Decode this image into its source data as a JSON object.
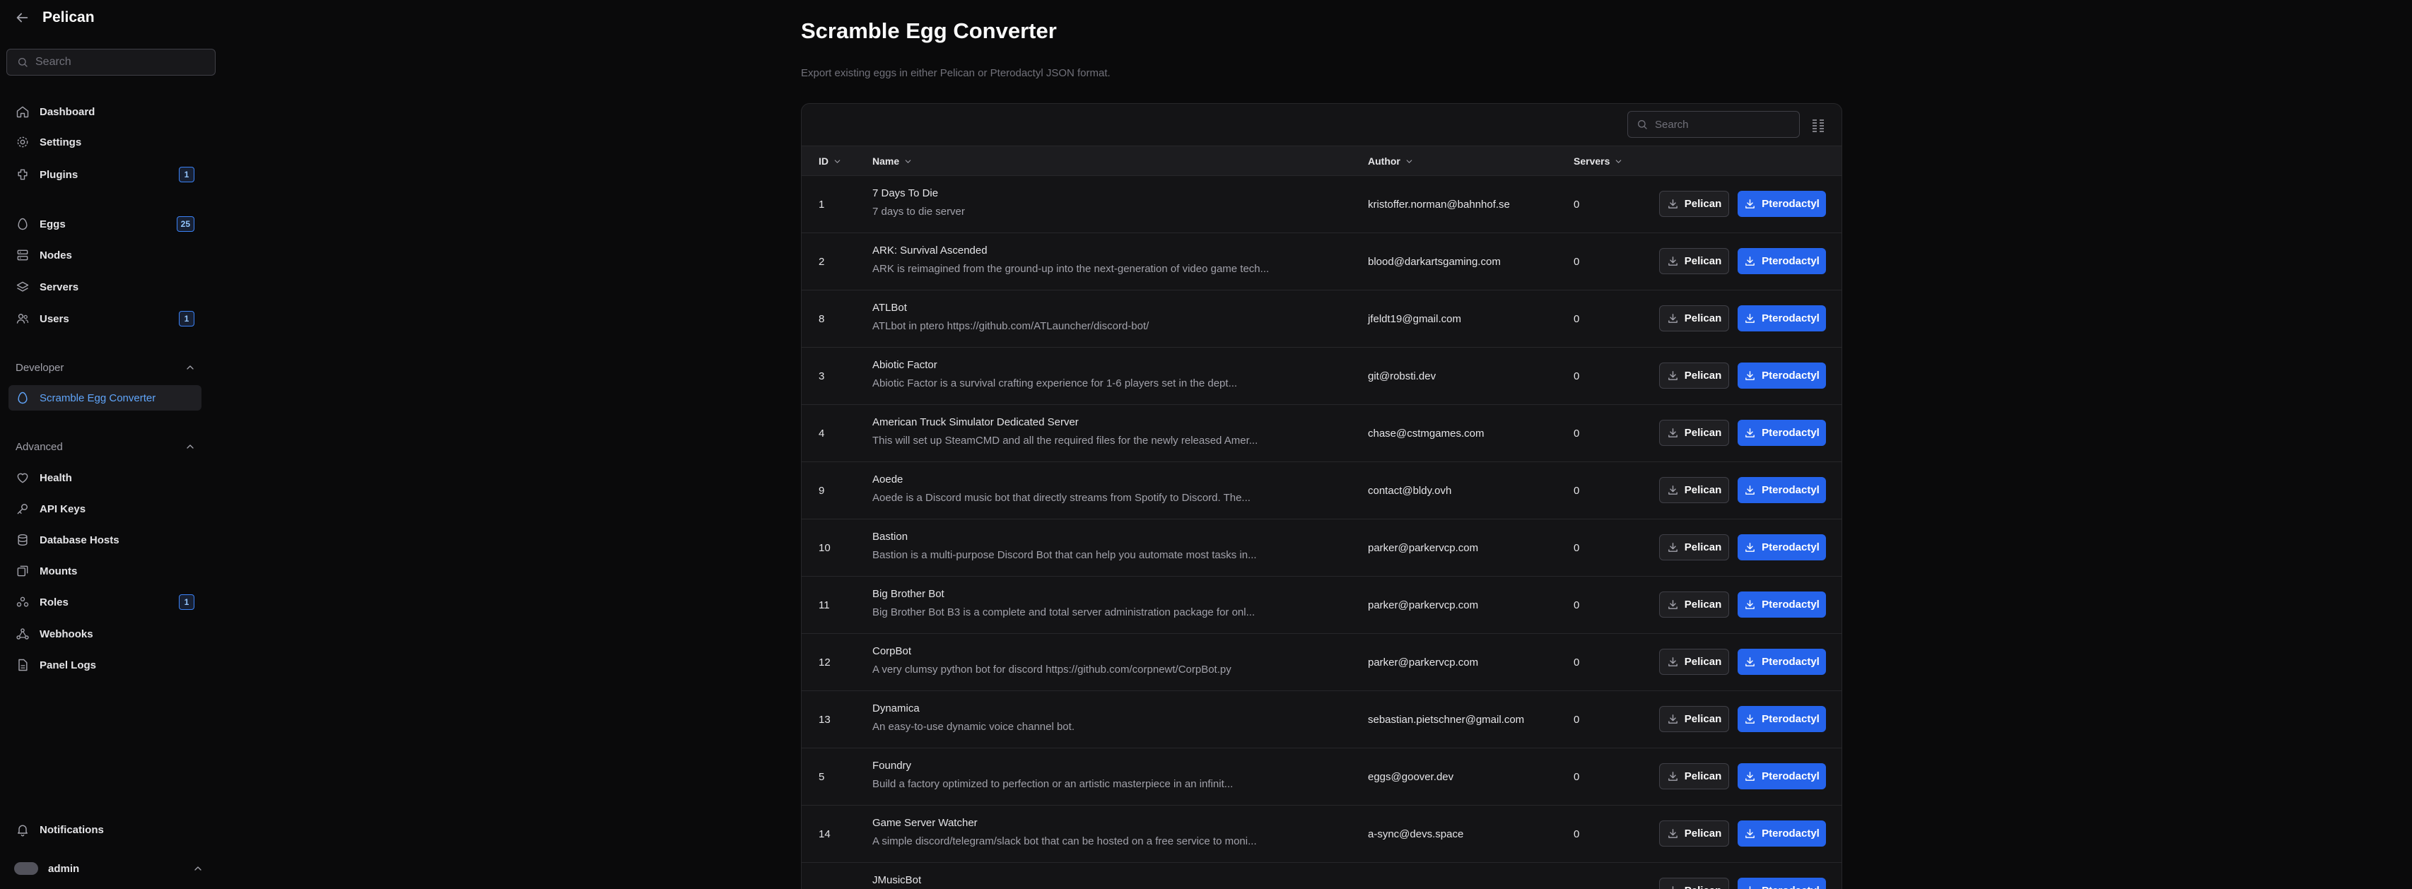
{
  "app": {
    "name": "Pelican"
  },
  "sidebar": {
    "search_placeholder": "Search",
    "items": [
      {
        "label": "Dashboard",
        "icon": "dashboard-icon"
      },
      {
        "label": "Settings",
        "icon": "gear-icon"
      },
      {
        "label": "Plugins",
        "icon": "plugin-icon",
        "badge": "1"
      },
      {
        "label": "Eggs",
        "icon": "egg-icon",
        "badge": "25"
      },
      {
        "label": "Nodes",
        "icon": "server-stack-icon"
      },
      {
        "label": "Servers",
        "icon": "brand-icon"
      },
      {
        "label": "Users",
        "icon": "users-icon",
        "badge": "1"
      }
    ],
    "developer": {
      "title": "Developer",
      "items": [
        {
          "label": "Scramble Egg Converter",
          "icon": "egg-icon",
          "active": true
        }
      ]
    },
    "advanced": {
      "title": "Advanced",
      "items": [
        {
          "label": "Health",
          "icon": "heart-icon"
        },
        {
          "label": "API Keys",
          "icon": "key-icon"
        },
        {
          "label": "Database Hosts",
          "icon": "database-icon"
        },
        {
          "label": "Mounts",
          "icon": "mounts-icon"
        },
        {
          "label": "Roles",
          "icon": "roles-icon",
          "badge": "1"
        },
        {
          "label": "Webhooks",
          "icon": "webhook-icon"
        },
        {
          "label": "Panel Logs",
          "icon": "file-icon"
        }
      ]
    },
    "notifications_label": "Notifications",
    "user_name": "admin"
  },
  "page": {
    "title": "Scramble Egg Converter",
    "subtitle": "Export existing eggs in either Pelican or Pterodactyl JSON format."
  },
  "table": {
    "search_placeholder": "Search",
    "columns": {
      "id": "ID",
      "name": "Name",
      "author": "Author",
      "servers": "Servers"
    },
    "pelican_label": "Pelican",
    "ptero_label": "Pterodactyl",
    "rows": [
      {
        "id": "1",
        "name": "7 Days To Die",
        "desc": "7 days to die server",
        "author": "kristoffer.norman@bahnhof.se",
        "servers": "0"
      },
      {
        "id": "2",
        "name": "ARK: Survival Ascended",
        "desc": "ARK is reimagined from the ground-up into the next-generation of video game tech...",
        "author": "blood@darkartsgaming.com",
        "servers": "0"
      },
      {
        "id": "8",
        "name": "ATLBot",
        "desc": "ATLbot in ptero https://github.com/ATLauncher/discord-bot/",
        "author": "jfeldt19@gmail.com",
        "servers": "0"
      },
      {
        "id": "3",
        "name": "Abiotic Factor",
        "desc": "Abiotic Factor is a survival crafting experience for 1-6 players set in the dept...",
        "author": "git@robsti.dev",
        "servers": "0"
      },
      {
        "id": "4",
        "name": "American Truck Simulator Dedicated Server",
        "desc": "This will set up SteamCMD and all the required files for the newly released Amer...",
        "author": "chase@cstmgames.com",
        "servers": "0"
      },
      {
        "id": "9",
        "name": "Aoede",
        "desc": "Aoede is a Discord music bot that directly streams from Spotify to Discord. The...",
        "author": "contact@bldy.ovh",
        "servers": "0"
      },
      {
        "id": "10",
        "name": "Bastion",
        "desc": "Bastion is a multi-purpose Discord Bot that can help you automate most tasks in...",
        "author": "parker@parkervcp.com",
        "servers": "0"
      },
      {
        "id": "11",
        "name": "Big Brother Bot",
        "desc": "Big Brother Bot B3 is a complete and total server administration package for onl...",
        "author": "parker@parkervcp.com",
        "servers": "0"
      },
      {
        "id": "12",
        "name": "CorpBot",
        "desc": "A very clumsy python bot for discord https://github.com/corpnewt/CorpBot.py",
        "author": "parker@parkervcp.com",
        "servers": "0"
      },
      {
        "id": "13",
        "name": "Dynamica",
        "desc": "An easy-to-use dynamic voice channel bot.",
        "author": "sebastian.pietschner@gmail.com",
        "servers": "0"
      },
      {
        "id": "5",
        "name": "Foundry",
        "desc": "Build a factory optimized to perfection or an artistic masterpiece in an infinit...",
        "author": "eggs@goover.dev",
        "servers": "0"
      },
      {
        "id": "14",
        "name": "Game Server Watcher",
        "desc": "A simple discord/telegram/slack bot that can be hosted on a free service to moni...",
        "author": "a-sync@devs.space",
        "servers": "0"
      },
      {
        "id": "",
        "name": "JMusicBot",
        "desc": "",
        "author": "",
        "servers": ""
      }
    ]
  },
  "colors": {
    "accent": "#2563eb",
    "active_text": "#60a5fa",
    "background": "#0a0a0b",
    "panel": "#141416"
  }
}
